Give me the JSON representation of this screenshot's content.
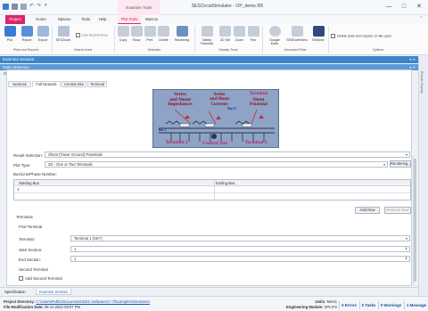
{
  "window": {
    "title": "SESCircuitSimulator - OP_demo.f05",
    "context_tab": "Examine Tools",
    "min": "—",
    "max": "□",
    "close": "✕"
  },
  "ribbon_tabs": [
    "Project",
    "Home",
    "Options",
    "Tools",
    "Help",
    "Plot Tools",
    "Macros"
  ],
  "ribbon": {
    "buttons": [
      {
        "label": "Plot",
        "icon": "plot-icon",
        "color": "#3a7bd5"
      },
      {
        "label": "Report",
        "icon": "report-icon",
        "color": "#5a8fd8"
      },
      {
        "label": "Export",
        "icon": "export-icon",
        "color": "#9fb7d8"
      },
      {
        "label": "SESZoom",
        "icon": "zoom-icon",
        "color": "#b5c3d6"
      },
      {
        "label": "Copy",
        "icon": "copy-icon",
        "color": "#c5cdd8"
      },
      {
        "label": "Show",
        "icon": "show-icon",
        "color": "#c5cdd8"
      },
      {
        "label": "Pref.",
        "icon": "preferences-icon",
        "color": "#c5cdd8"
      },
      {
        "label": "Delete",
        "icon": "delete-icon",
        "color": "#c5cdd8"
      },
      {
        "label": "Rendering",
        "icon": "rendering-icon",
        "color": "#6f8fbf"
      },
      {
        "label": "Safety Potential",
        "icon": "safety-icon",
        "color": "#c5cdd8"
      },
      {
        "label": "3D Std",
        "icon": "cube-icon",
        "color": "#c5cdd8"
      },
      {
        "label": "Zoom",
        "icon": "zoom-area-icon",
        "color": "#c5cdd8"
      },
      {
        "label": "Pan",
        "icon": "pan-icon",
        "color": "#c5cdd8"
      },
      {
        "label": "Google Earth",
        "icon": "globe-icon",
        "color": "#c5cdd8"
      },
      {
        "label": "SESEarthView",
        "icon": "earthview-icon",
        "color": "#c5cdd8"
      },
      {
        "label": "EMInner",
        "icon": "eminner-icon",
        "color": "#2f4a78"
      }
    ],
    "file_search": "Use Search Area",
    "delete_option": "Delete plots and reports on file open",
    "groups": [
      "Plots and Reports",
      "Search Area",
      "Selection",
      "Display Tools",
      "Advanced Plots",
      "Options"
    ]
  },
  "panes": {
    "outer": "Examine Session",
    "inner": "Data Selection",
    "schematic": "Schematic",
    "right_strip": "Results Display"
  },
  "subtabs": [
    "Sections",
    "Full Network",
    "Central Site",
    "Terminal"
  ],
  "diagram": {
    "texts": [
      "Series",
      "and Shunt",
      "Impedances",
      "Series",
      "and Shunt",
      "Currents",
      "Terminal",
      "Shunt",
      "Potential",
      "Bus 1",
      "Bus N",
      "Terminal 1",
      "Central Site",
      "Terminal 2"
    ]
  },
  "form": {
    "result_selection_label": "Result Selection:",
    "result_selection_value": "Shunt (Tower Ground) Potentials",
    "plot_type_label": "Plot Type:",
    "plot_type_value": "2D - One or Two Terminals",
    "rendering_button": "Rendering...",
    "bus_line_label": "Bus/Line/Phase Number:",
    "starting_bus": "Starting Bus",
    "ending_bus": "Ending Bus",
    "row_value": "1",
    "add_row": "Add Row",
    "remove_row": "Remove Row",
    "terminals_label": "Terminals",
    "first_terminal": "First Terminal",
    "terminal_label": "Terminal:",
    "terminal_value": "Terminal 1 (SKY)",
    "start_section_label": "Start Section:",
    "start_section_value": "1",
    "end_section_label": "End Section:",
    "end_section_value": "1",
    "second_terminal": "Second Terminal",
    "add_second_terminal": "Add Second Terminal"
  },
  "bottom_tabs": [
    "Specification",
    "Examine Session"
  ],
  "status": {
    "project_directory_label": "Project Directory:",
    "project_directory": "C:\\Users\\Public\\Documents\\SES Software\\17.7\\Examples\\OneDemo",
    "file_date_label": "File Modification Date:",
    "file_date": "08-11-2022 09:07 PM",
    "units_label": "Units:",
    "units": "Metric",
    "module_label": "Engineering Module:",
    "module": "SPLITS",
    "errors": "0 Errors",
    "tasks": "0 Tasks",
    "warnings": "0 Warnings",
    "messages": "1 Message"
  },
  "colors": {
    "accent": "#d9276b",
    "pane": "#3b87c9",
    "diagram_bg": "#8aa0c3",
    "diagram_text": "#8a1322"
  }
}
